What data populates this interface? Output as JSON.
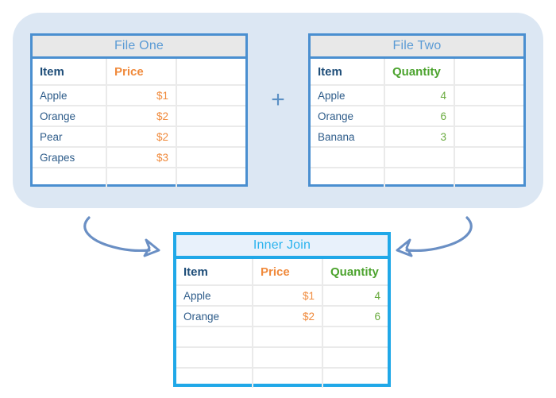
{
  "diagram": {
    "title": "Inner Join",
    "plus_symbol": "+",
    "colors": {
      "panel_bg": "#dce7f3",
      "source_border": "#4a8fd0",
      "result_border": "#20a8e8",
      "price_accent": "#f08a3c",
      "quantity_accent": "#4ca32e",
      "item_accent": "#1f4e79",
      "arrow": "#6a8fc4"
    }
  },
  "file_one": {
    "title": "File One",
    "headers": [
      "Item",
      "Price",
      ""
    ],
    "rows": [
      [
        "Apple",
        "$1",
        ""
      ],
      [
        "Orange",
        "$2",
        ""
      ],
      [
        "Pear",
        "$2",
        ""
      ],
      [
        "Grapes",
        "$3",
        ""
      ],
      [
        "",
        "",
        ""
      ]
    ]
  },
  "file_two": {
    "title": "File Two",
    "headers": [
      "Item",
      "Quantity",
      ""
    ],
    "rows": [
      [
        "Apple",
        "4",
        ""
      ],
      [
        "Orange",
        "6",
        ""
      ],
      [
        "Banana",
        "3",
        ""
      ],
      [
        "",
        "",
        ""
      ],
      [
        "",
        "",
        ""
      ]
    ]
  },
  "inner_join": {
    "title": "Inner Join",
    "headers": [
      "Item",
      "Price",
      "Quantity"
    ],
    "rows": [
      [
        "Apple",
        "$1",
        "4"
      ],
      [
        "Orange",
        "$2",
        "6"
      ],
      [
        "",
        "",
        ""
      ],
      [
        "",
        "",
        ""
      ],
      [
        "",
        "",
        ""
      ]
    ]
  },
  "arrows": {
    "left": "arrow-to-result-left",
    "right": "arrow-to-result-right"
  }
}
